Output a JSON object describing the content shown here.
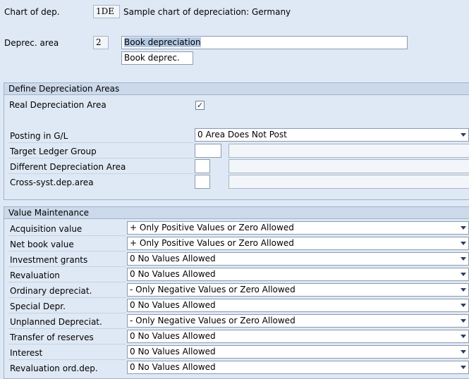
{
  "header": {
    "chart_label": "Chart of dep.",
    "chart_value": "1DE",
    "chart_desc": "Sample chart of depreciation: Germany",
    "area_label": "Deprec. area",
    "area_value": "2",
    "area_name": "Book depreciation",
    "area_short": "Book deprec."
  },
  "define": {
    "title": "Define Depreciation Areas",
    "real_label": "Real Depreciation Area",
    "real_checked": "✓",
    "posting_label": "Posting in G/L",
    "posting_value": "0 Area Does Not Post",
    "target_label": "Target Ledger Group",
    "diff_label": "Different Depreciation Area",
    "cross_label": "Cross-syst.dep.area"
  },
  "value_maintenance": {
    "title": "Value Maintenance",
    "rows": [
      {
        "label": "Acquisition value",
        "value": "+ Only Positive Values or Zero Allowed"
      },
      {
        "label": "Net book value",
        "value": "+ Only Positive Values or Zero Allowed"
      },
      {
        "label": "Investment grants",
        "value": "0 No Values Allowed"
      },
      {
        "label": "Revaluation",
        "value": "0 No Values Allowed"
      },
      {
        "label": "Ordinary depreciat.",
        "value": "- Only Negative Values or Zero Allowed"
      },
      {
        "label": "Special Depr.",
        "value": "0 No Values Allowed"
      },
      {
        "label": "Unplanned Depreciat.",
        "value": "- Only Negative Values or Zero Allowed"
      },
      {
        "label": "Transfer of reserves",
        "value": "0 No Values Allowed"
      },
      {
        "label": "Interest",
        "value": "0 No Values Allowed"
      },
      {
        "label": "Revaluation ord.dep.",
        "value": "0 No Values Allowed"
      }
    ]
  }
}
